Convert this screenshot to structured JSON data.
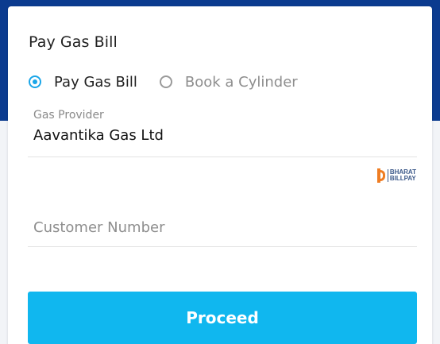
{
  "card": {
    "title": "Pay Gas Bill"
  },
  "mode": {
    "options": [
      {
        "label": "Pay Gas Bill",
        "selected": true
      },
      {
        "label": "Book a Cylinder",
        "selected": false
      }
    ]
  },
  "provider": {
    "label": "Gas Provider",
    "value": "Aavantika Gas Ltd"
  },
  "bbps": {
    "logo_text_line1": "BHARAT",
    "logo_text_line2": "BILLPAY",
    "icon": "bharat-billpay-logo"
  },
  "customer": {
    "placeholder": "Customer Number",
    "value": ""
  },
  "actions": {
    "proceed_label": "Proceed"
  },
  "colors": {
    "header_band": "#0b3b8f",
    "accent": "#1aa6e8",
    "button": "#10b7ef",
    "bbps_orange": "#ef7d23"
  }
}
